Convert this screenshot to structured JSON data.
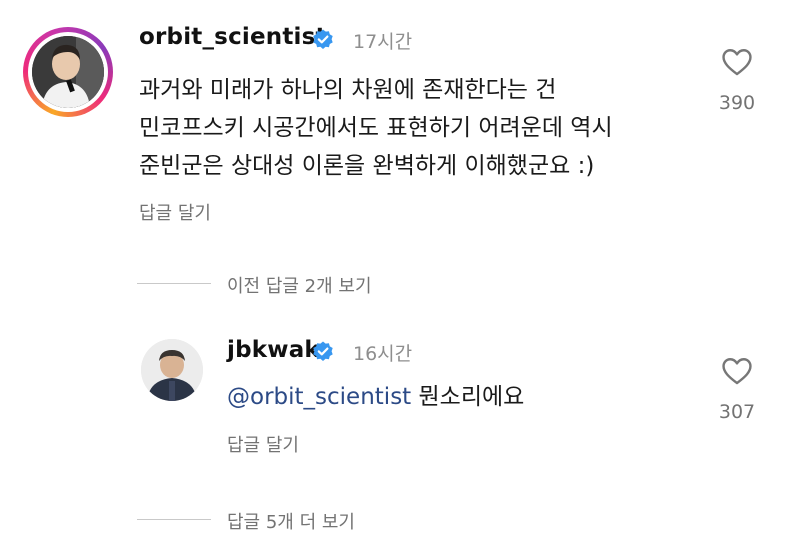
{
  "comment": {
    "username": "orbit_scientist",
    "time": "17시간",
    "lines": [
      "과거와 미래가 하나의 차원에 존재한다는 건",
      "민코프스키 시공간에서도 표현하기 어려운데 역시",
      "준빈군은 상대성 이론을 완벽하게 이해했군요 :)"
    ],
    "reply_label": "답글 달기",
    "like_count": "390",
    "avatar_icon": "profile-photo",
    "verified_icon": "verified-badge-icon",
    "like_icon": "heart-outline-icon"
  },
  "previous_replies_label": "이전 답글 2개 보기",
  "reply": {
    "username": "jbkwak",
    "time": "16시간",
    "mention": "@orbit_scientist",
    "text": " 뭔소리에요",
    "reply_label": "답글 달기",
    "like_count": "307",
    "avatar_icon": "profile-photo",
    "verified_icon": "verified-badge-icon",
    "like_icon": "heart-outline-icon"
  },
  "more_replies_label": "답글 5개 더 보기",
  "colors": {
    "verified": "#3897f0",
    "mention": "#2c4a86",
    "secondary_text": "#737373"
  }
}
